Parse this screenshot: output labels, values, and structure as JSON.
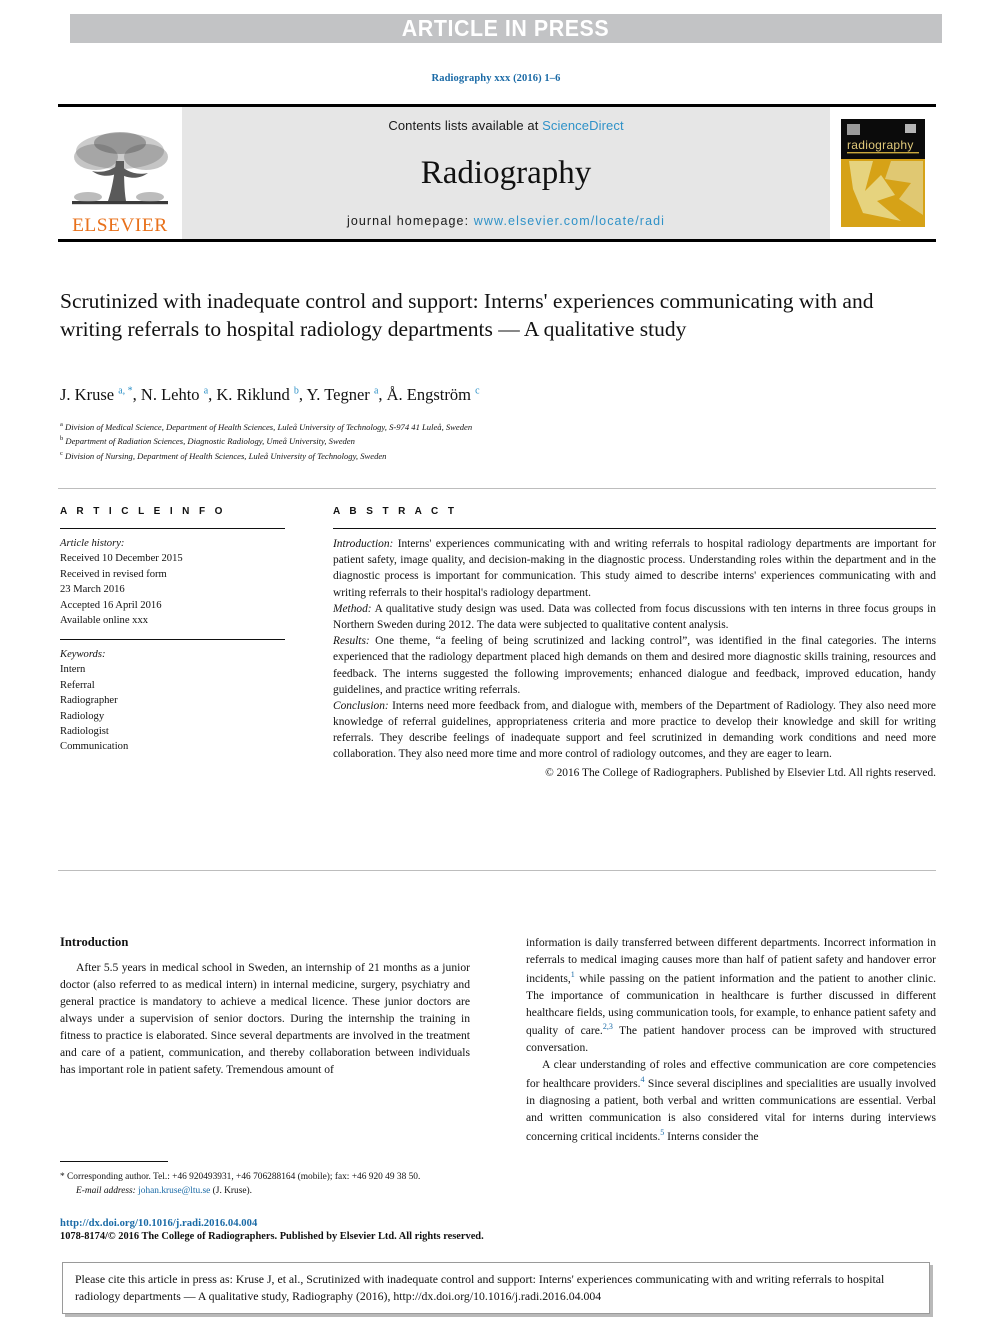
{
  "banner": {
    "text": "ARTICLE IN PRESS"
  },
  "journal_ref": "Radiography xxx (2016) 1–6",
  "masthead": {
    "contents_prefix": "Contents lists available at ",
    "sciencedirect": "ScienceDirect",
    "journal_name": "Radiography",
    "homepage_prefix": "journal homepage: ",
    "homepage_url": "www.elsevier.com/locate/radi",
    "publisher_wordmark": "ELSEVIER",
    "cover_title": "radiography",
    "colors": {
      "link_blue": "#2f92c8",
      "elsevier_orange": "#e8701a",
      "banner_grey": "#c2c3c5",
      "masthead_grey": "#e6e6e6",
      "cover_gold": "#d6a217",
      "cover_gold_light": "#e5cf7a"
    }
  },
  "article": {
    "title": "Scrutinized with inadequate control and support: Interns' experiences communicating with and writing referrals to hospital radiology departments — A qualitative study",
    "authors_html": "J. Kruse <sup>a, *</sup>, N. Lehto <sup>a</sup>, K. Riklund <sup>b</sup>, Y. Tegner <sup>a</sup>, Å. Engström <sup>c</sup>",
    "affiliations": [
      {
        "marker": "a",
        "text": "Division of Medical Science, Department of Health Sciences, Luleå University of Technology, S-974 41 Luleå, Sweden"
      },
      {
        "marker": "b",
        "text": "Department of Radiation Sciences, Diagnostic Radiology, Umeå University, Sweden"
      },
      {
        "marker": "c",
        "text": "Division of Nursing, Department of Health Sciences, Luleå University of Technology, Sweden"
      }
    ]
  },
  "article_info": {
    "heading": "A R T I C L E  I N F O",
    "history_label": "Article history:",
    "history": [
      "Received 10 December 2015",
      "Received in revised form",
      "23 March 2016",
      "Accepted 16 April 2016",
      "Available online xxx"
    ],
    "keywords_label": "Keywords:",
    "keywords": [
      "Intern",
      "Referral",
      "Radiographer",
      "Radiology",
      "Radiologist",
      "Communication"
    ]
  },
  "abstract": {
    "heading": "A B S T R A C T",
    "sections": [
      {
        "label": "Introduction:",
        "text": " Interns' experiences communicating with and writing referrals to hospital radiology departments are important for patient safety, image quality, and decision-making in the diagnostic process. Understanding roles within the department and in the diagnostic process is important for communication. This study aimed to describe interns' experiences communicating with and writing referrals to their hospital's radiology department."
      },
      {
        "label": "Method:",
        "text": " A qualitative study design was used. Data was collected from focus discussions with ten interns in three focus groups in Northern Sweden during 2012. The data were subjected to qualitative content analysis."
      },
      {
        "label": "Results:",
        "text": " One theme, “a feeling of being scrutinized and lacking control”, was identified in the final categories. The interns experienced that the radiology department placed high demands on them and desired more diagnostic skills training, resources and feedback. The interns suggested the following improvements; enhanced dialogue and feedback, improved education, handy guidelines, and practice writing referrals."
      },
      {
        "label": "Conclusion:",
        "text": " Interns need more feedback from, and dialogue with, members of the Department of Radiology. They also need more knowledge of referral guidelines, appropriateness criteria and more practice to develop their knowledge and skill for writing referrals. They describe feelings of inadequate support and feel scrutinized in demanding work conditions and need more collaboration. They also need more time and more control of radiology outcomes, and they are eager to learn."
      }
    ],
    "copyright": "© 2016 The College of Radiographers. Published by Elsevier Ltd. All rights reserved."
  },
  "body": {
    "left_heading": "Introduction",
    "left_paragraph": "After 5.5 years in medical school in Sweden, an internship of 21 months as a junior doctor (also referred to as medical intern) in internal medicine, surgery, psychiatry and general practice is mandatory to achieve a medical licence. These junior doctors are always under a supervision of senior doctors. During the internship the training in fitness to practice is elaborated. Since several departments are involved in the treatment and care of a patient, communication, and thereby collaboration between individuals has important role in patient safety. Tremendous amount of",
    "right_paragraph_1_html": "information is daily transferred between different departments. Incorrect information in referrals to medical imaging causes more than half of patient safety and handover error incidents,<sup>1</sup> while passing on the patient information and the patient to another clinic. The importance of communication in healthcare is further discussed in different healthcare fields, using communication tools, for example, to enhance patient safety and quality of care.<sup>2,3</sup> The patient handover process can be improved with structured conversation.",
    "right_paragraph_2_html": "A clear understanding of roles and effective communication are core competencies for healthcare providers.<sup>4</sup> Since several disciplines and specialities are usually involved in diagnosing a patient, both verbal and written communications are essential. Verbal and written communication is also considered vital for interns during interviews concerning critical incidents.<sup>5</sup> Interns consider the"
  },
  "footnote": {
    "corresponding": "* Corresponding author. Tel.: +46 920493931, +46 706288164 (mobile); fax: +46 920 49 38 50.",
    "email_label": "E-mail address:",
    "email": "johan.kruse@ltu.se",
    "email_owner": "(J. Kruse)."
  },
  "footer": {
    "doi": "http://dx.doi.org/10.1016/j.radi.2016.04.004",
    "issn_line": "1078-8174/© 2016 The College of Radiographers. Published by Elsevier Ltd. All rights reserved."
  },
  "cite_box": {
    "text": "Please cite this article in press as: Kruse J, et al., Scrutinized with inadequate control and support: Interns' experiences communicating with and writing referrals to hospital radiology departments — A qualitative study, Radiography (2016), http://dx.doi.org/10.1016/j.radi.2016.04.004"
  }
}
